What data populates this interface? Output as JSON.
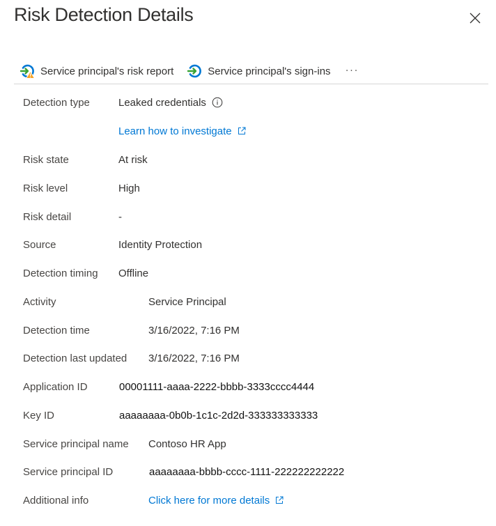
{
  "header": {
    "title": "Risk Detection Details",
    "close_icon": "close-icon"
  },
  "toolbar": {
    "risk_report_label": "Service principal's risk report",
    "risk_report_icon": "sign-in-warning-icon",
    "signins_label": "Service principal's sign-ins",
    "signins_icon": "sign-in-icon",
    "more_label": "···"
  },
  "colors": {
    "link": "#0078d4",
    "icon_green": "#3aa335",
    "icon_blue": "#0078d4",
    "warning": "#f7a325"
  },
  "details": {
    "detection_type": {
      "label": "Detection type",
      "value": "Leaked credentials",
      "info_icon": "info-icon"
    },
    "investigate_link": {
      "label": "Learn how to investigate",
      "icon": "external-link-icon"
    },
    "risk_state": {
      "label": "Risk state",
      "value": "At risk"
    },
    "risk_level": {
      "label": "Risk level",
      "value": "High"
    },
    "risk_detail": {
      "label": "Risk detail",
      "value": "-"
    },
    "source": {
      "label": "Source",
      "value": "Identity Protection"
    },
    "detection_timing": {
      "label": "Detection timing",
      "value": "Offline"
    },
    "activity": {
      "label": "Activity",
      "value": "Service Principal"
    },
    "detection_time": {
      "label": "Detection time",
      "value": "3/16/2022, 7:16 PM"
    },
    "detection_last_updated": {
      "label": "Detection last updated",
      "value": "3/16/2022, 7:16 PM"
    },
    "application_id": {
      "label": "Application ID",
      "value": "00001111-aaaa-2222-bbbb-3333cccc4444"
    },
    "key_id": {
      "label": "Key ID",
      "value": "aaaaaaaa-0b0b-1c1c-2d2d-333333333333"
    },
    "service_principal_name": {
      "label": "Service principal name",
      "value": "Contoso HR App"
    },
    "service_principal_id": {
      "label": "Service principal ID",
      "value": "aaaaaaaa-bbbb-cccc-1111-222222222222"
    },
    "additional_info": {
      "label": "Additional info",
      "link": "Click here for more details",
      "icon": "external-link-icon"
    }
  }
}
